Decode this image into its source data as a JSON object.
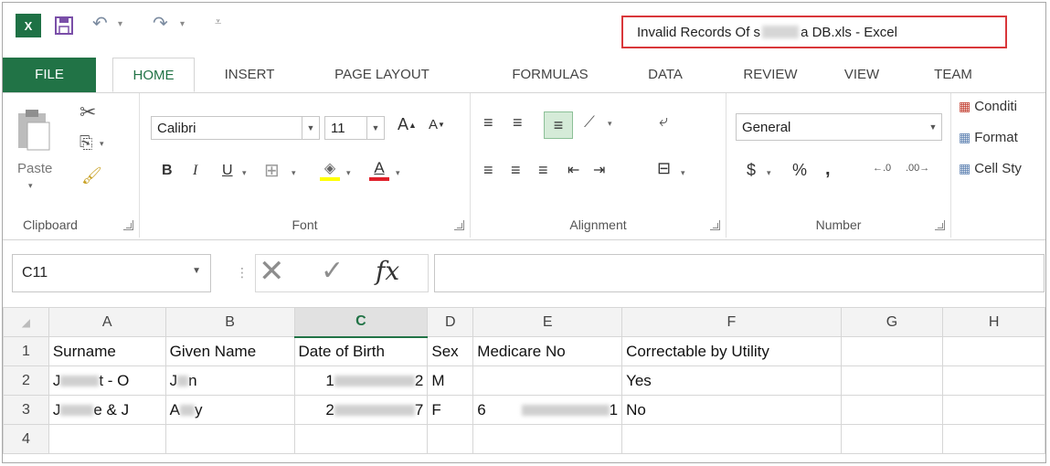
{
  "titlebar": {
    "excel_logo": "X",
    "title_prefix": "Invalid Records Of s",
    "title_suffix": "a DB.xls - Excel"
  },
  "tabs": [
    "FILE",
    "HOME",
    "INSERT",
    "PAGE LAYOUT",
    "FORMULAS",
    "DATA",
    "REVIEW",
    "VIEW",
    "TEAM"
  ],
  "ribbon": {
    "clipboard": {
      "paste": "Paste",
      "label": "Clipboard"
    },
    "font": {
      "name": "Calibri",
      "size": "11",
      "bold": "B",
      "italic": "I",
      "underline": "U",
      "grow": "A",
      "shrink": "A",
      "font_color": "A",
      "label": "Font"
    },
    "alignment": {
      "label": "Alignment"
    },
    "number": {
      "format": "General",
      "currency": "$",
      "percent": "%",
      "comma": ",",
      "label": "Number"
    },
    "styles": {
      "conditional": "Conditi",
      "format_table": "Format",
      "cell_styles": "Cell Sty"
    }
  },
  "formula_bar": {
    "name_box": "C11",
    "fx": "fx"
  },
  "grid": {
    "columns": [
      "A",
      "B",
      "C",
      "D",
      "E",
      "F",
      "G",
      "H"
    ],
    "rows": [
      {
        "num": "1",
        "cells": [
          "Surname",
          "Given Name",
          "Date of Birth",
          "Sex",
          "Medicare No",
          "Correctable by Utility",
          "",
          ""
        ]
      },
      {
        "num": "2",
        "cells": [
          "J",
          "t - O",
          "J",
          "n",
          "1",
          "2",
          "M",
          "",
          "Yes"
        ]
      },
      {
        "num": "3",
        "cells": [
          "J",
          "e & J",
          "A",
          "y",
          "2",
          "7",
          "F",
          "6",
          "1",
          "No"
        ]
      },
      {
        "num": "4",
        "cells": []
      }
    ]
  },
  "colors": {
    "excel_green": "#217346",
    "highlight_red": "#d9373a"
  }
}
